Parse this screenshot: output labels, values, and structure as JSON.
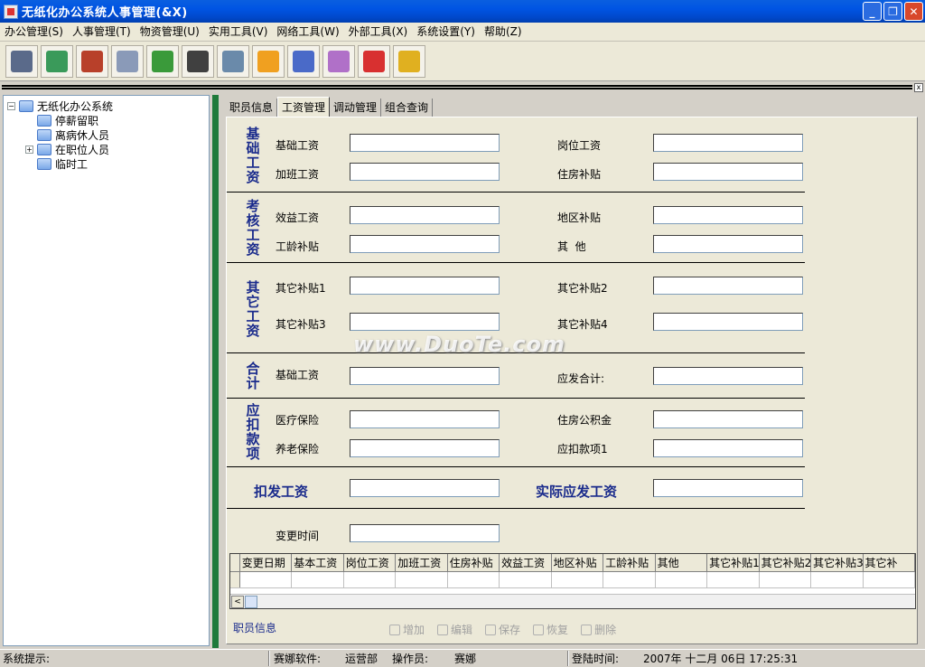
{
  "window": {
    "title": "无纸化办公系统人事管理(&X)",
    "minimize": "_",
    "restore": "❐",
    "close": "✕"
  },
  "menu": [
    "办公管理(S)",
    "人事管理(T)",
    "物资管理(U)",
    "实用工具(V)",
    "网络工具(W)",
    "外部工具(X)",
    "系统设置(Y)",
    "帮助(Z)"
  ],
  "toolbar": {
    "buttons": [
      {
        "name": "camera-icon",
        "color": "#5a6a8a"
      },
      {
        "name": "network-icon",
        "color": "#3a9a5a"
      },
      {
        "name": "books-icon",
        "color": "#b8402a"
      },
      {
        "name": "printer-icon",
        "color": "#8a9ab8"
      },
      {
        "name": "compass-icon",
        "color": "#3a9a3a"
      },
      {
        "name": "scanner-icon",
        "color": "#404040"
      },
      {
        "name": "card-add-icon",
        "color": "#6a8aaa"
      },
      {
        "name": "sun-icon",
        "color": "#f0a020"
      },
      {
        "name": "notebook-blue-icon",
        "color": "#4a6ac8"
      },
      {
        "name": "notebook-purple-icon",
        "color": "#b070c8"
      },
      {
        "name": "heart-icon",
        "color": "#d83030"
      },
      {
        "name": "exit-icon",
        "color": "#e0b020"
      }
    ]
  },
  "strip": {
    "close": "x"
  },
  "tree": {
    "root": {
      "label": "无纸化办公系统",
      "expander": "−"
    },
    "children": [
      {
        "label": "停薪留职",
        "expander": ""
      },
      {
        "label": "离病休人员",
        "expander": ""
      },
      {
        "label": "在职位人员",
        "expander": "+"
      },
      {
        "label": "临时工",
        "expander": ""
      }
    ]
  },
  "tabs": [
    "职员信息",
    "工资管理",
    "调动管理",
    "组合查询"
  ],
  "form": {
    "sections": {
      "basic": "基础工资",
      "assess": "考核工资",
      "other": "其它工资",
      "total": "合计",
      "deduct": "应扣款项"
    },
    "labels": {
      "base_salary": "基础工资",
      "post_salary": "岗位工资",
      "overtime_salary": "加班工资",
      "housing_subsidy": "住房补贴",
      "benefit_salary": "效益工资",
      "region_subsidy": "地区补贴",
      "seniority_subsidy": "工龄补贴",
      "others": "其  他",
      "other_subsidy_1": "其它补贴1",
      "other_subsidy_2": "其它补贴2",
      "other_subsidy_3": "其它补贴3",
      "other_subsidy_4": "其它补贴4",
      "total_base": "基础工资",
      "total_payable": "应发合计:",
      "medical_insurance": "医疗保险",
      "housing_fund": "住房公积金",
      "pension_insurance": "养老保险",
      "deduction_1": "应扣款项1",
      "deduct_salary": "扣发工资",
      "actual_salary": "实际应发工资",
      "change_time": "变更时间"
    },
    "watermark": "www.DuoTe.com"
  },
  "grid": {
    "columns": [
      "变更日期",
      "基本工资",
      "岗位工资",
      "加班工资",
      "住房补贴",
      "效益工资",
      "地区补贴",
      "工龄补贴",
      "其他",
      "其它补贴1",
      "其它补贴2",
      "其它补贴3",
      "其它补"
    ],
    "left_arrow": "<"
  },
  "footer": {
    "label": "职员信息",
    "actions": [
      "增加",
      "编辑",
      "保存",
      "恢复",
      "删除"
    ]
  },
  "status": {
    "hint": "系统提示:",
    "software": "赛娜软件:",
    "dept": "运营部",
    "operator_label": "操作员:",
    "operator": "赛娜",
    "login_label": "登陆时间:",
    "login_time": "2007年 十二月 06日 17:25:31"
  }
}
